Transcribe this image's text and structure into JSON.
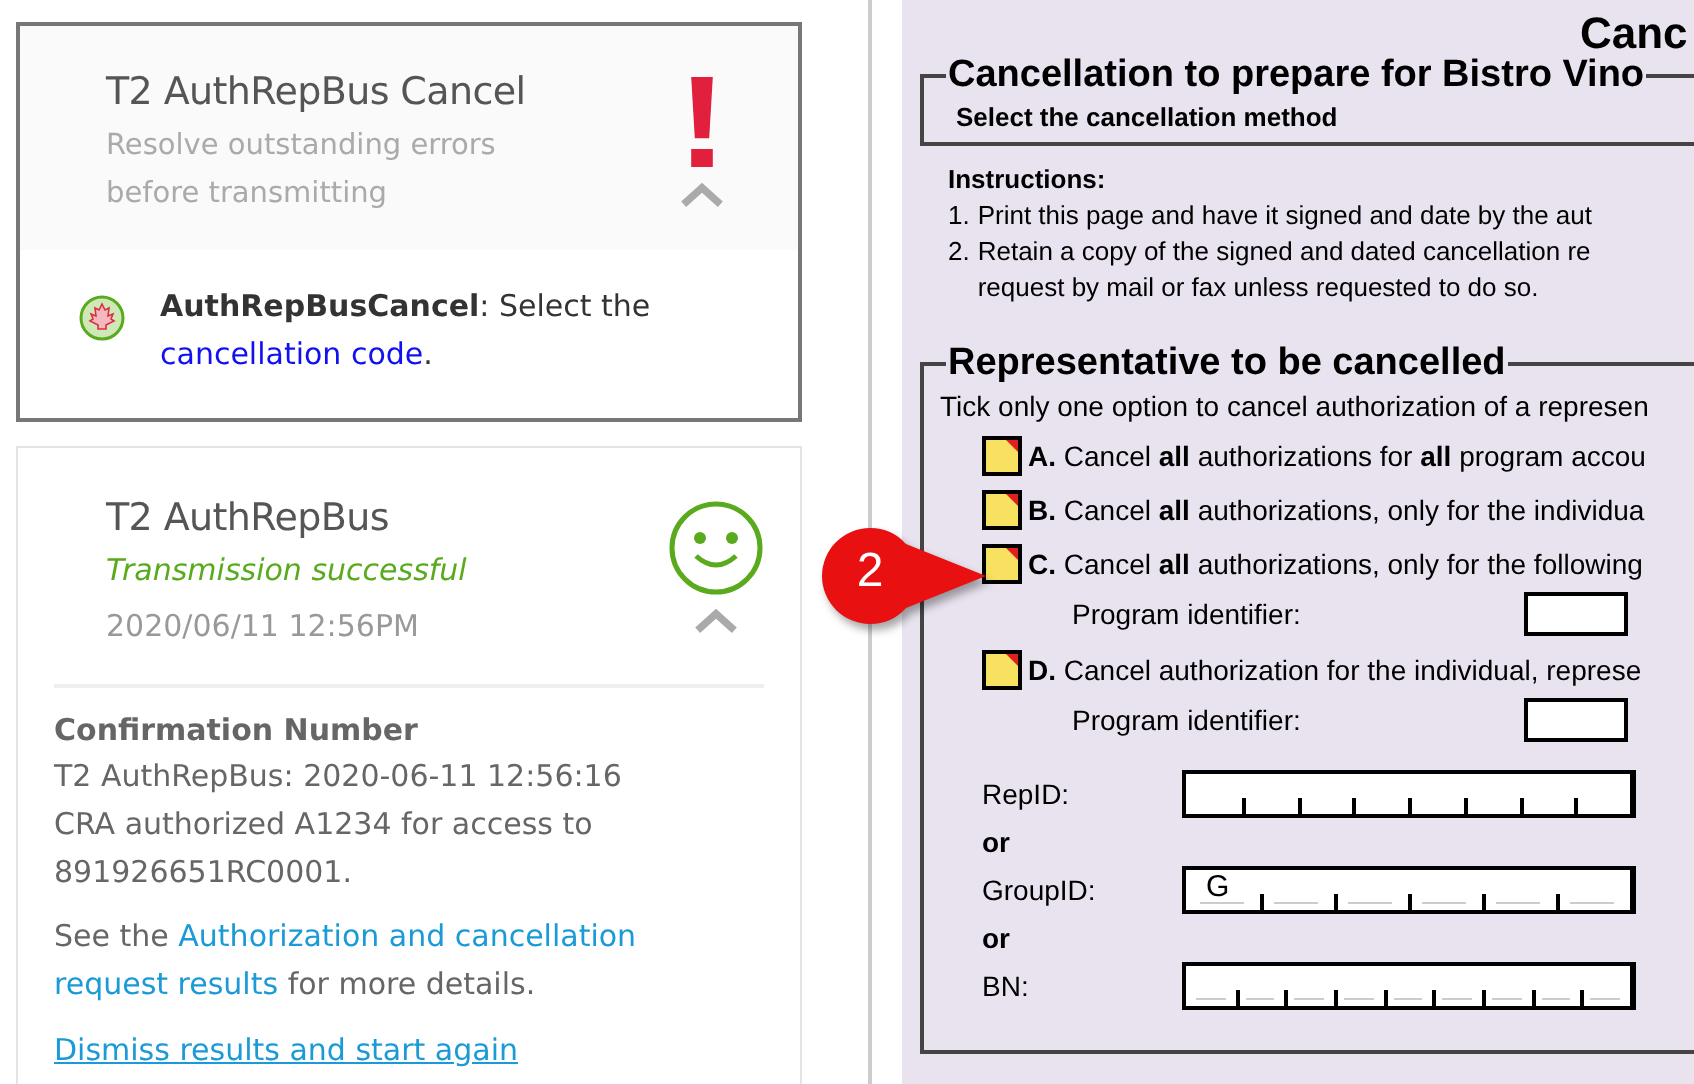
{
  "error_card": {
    "title": "T2 AuthRepBus Cancel",
    "kind": "error",
    "message": [
      "Resolve outstanding errors",
      "before transmitting"
    ],
    "expanded": true,
    "errors": [
      {
        "text": "**AuthRepBusCancel**: Select the",
        "link": "cancellation code",
        "after": "."
      }
    ]
  },
  "success_card": {
    "title": "T2 AuthRepBus",
    "kind": "success",
    "status_text": "Transmission successful",
    "timestamp": "2020/06/11 12:56PM",
    "expanded": true,
    "confirmation_heading": "Confirmation Number",
    "confirmation_lines": [
      "T2 AuthRepBus: 2020-06-11 12:56:16",
      "CRA authorized A1234 for access to",
      "891926651RC0001."
    ],
    "details": {
      "before": "See the",
      "link_lines": [
        "Authorization and cancellation",
        "request results"
      ],
      "after": "for more details."
    },
    "dismiss_link": "Dismiss results and start again"
  },
  "callout": {
    "text": "2"
  },
  "form": {
    "heading": "Canc",
    "method_section": {
      "legend": "Cancellation to prepare for Bistro Vino",
      "label": "Select the cancellation method"
    },
    "instructions": {
      "title": "Instructions:",
      "items": [
        {
          "number": "1.",
          "lines": [
            "Print this page and have it signed and date by the aut"
          ]
        },
        {
          "number": "2.",
          "lines": [
            "Retain a copy of the signed and dated cancellation re",
            "request by mail or fax unless requested to do so."
          ]
        }
      ]
    },
    "rep_section": {
      "legend": "Representative to be cancelled",
      "intro": "Tick only one option to cancel authorization of a represen",
      "options": [
        {
          "letter": "A.",
          "text": "Cancel **all** authorizations for **all** program accou",
          "checked": false
        },
        {
          "letter": "B.",
          "text": "Cancel **all** authorizations, only for the individua",
          "checked": false
        },
        {
          "letter": "C.",
          "text": "Cancel **all** authorizations, only for the following",
          "checked": false,
          "sub_label": "Program identifier:"
        },
        {
          "letter": "D.",
          "text": "Cancel authorization for the individual, represe",
          "checked": false,
          "sub_label": "Program identifier:"
        }
      ],
      "id_rows": [
        {
          "kind": "rep_field",
          "label": "RepID:"
        },
        {
          "kind": "or",
          "text": "or"
        },
        {
          "kind": "group_field",
          "label": "GroupID:",
          "value": "G"
        },
        {
          "kind": "or",
          "text": "or"
        },
        {
          "kind": "bn_field",
          "label": "BN:"
        }
      ]
    }
  }
}
